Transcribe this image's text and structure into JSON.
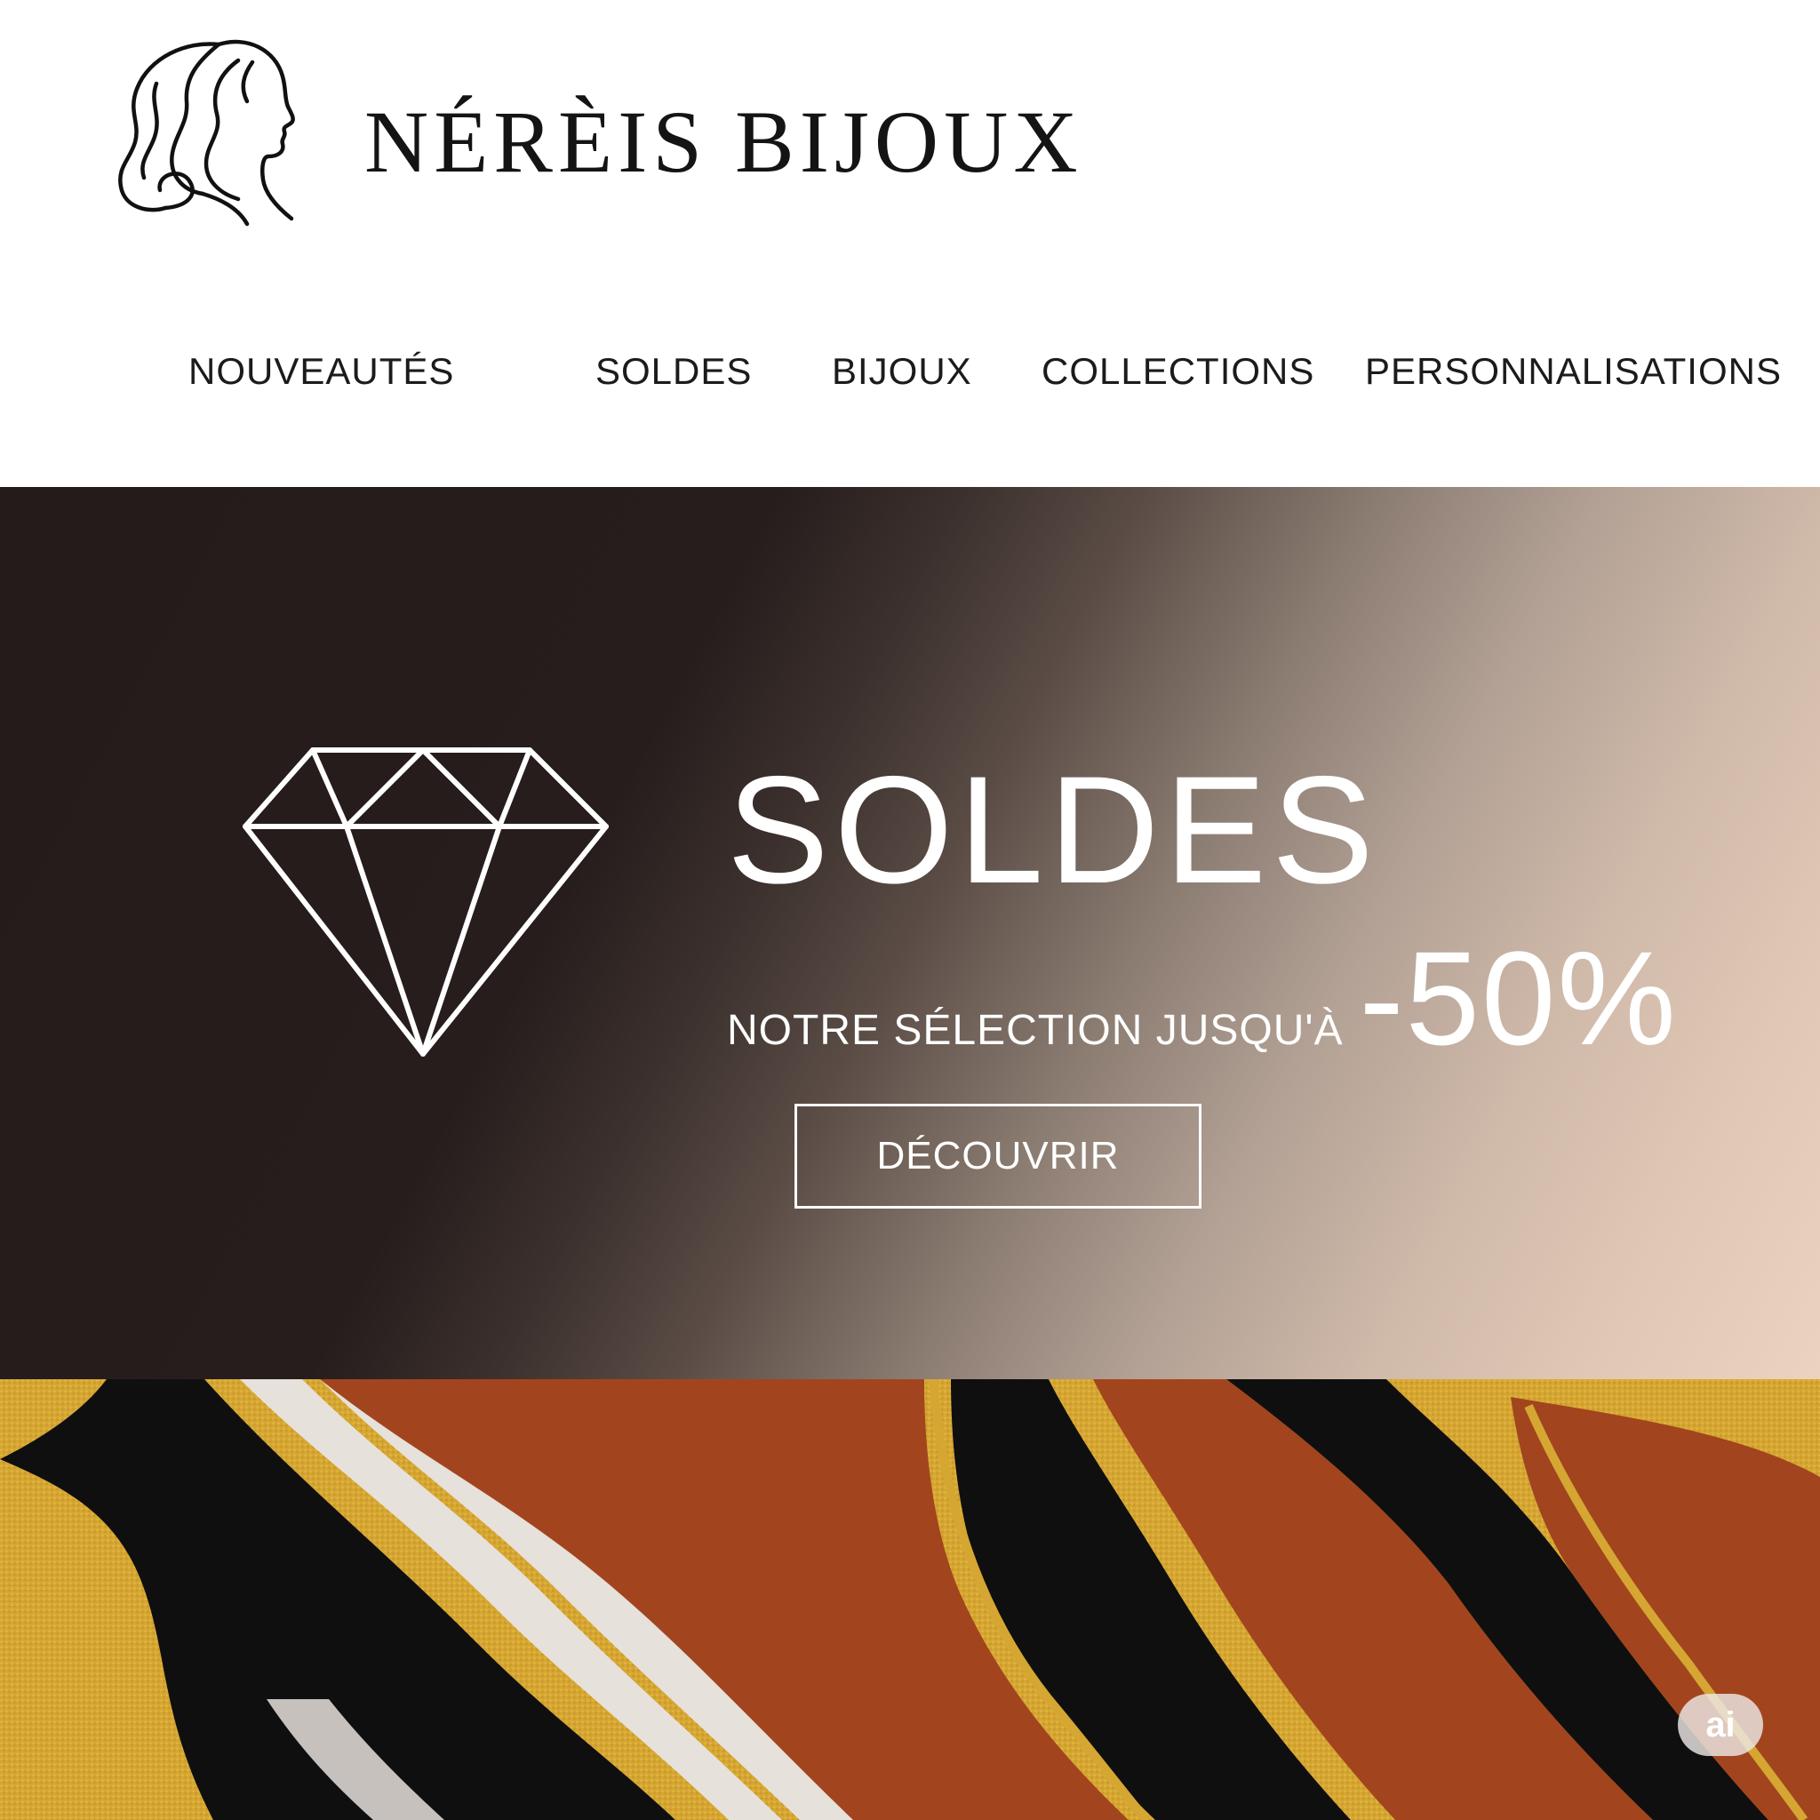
{
  "brand": {
    "name": "NÉRÈIS BIJOUX",
    "logo_icon": "woman-profile-icon"
  },
  "nav": {
    "items": [
      {
        "label": "NOUVEAUTÉS"
      },
      {
        "label": "SOLDES"
      },
      {
        "label": "BIJOUX"
      },
      {
        "label": "COLLECTIONS"
      },
      {
        "label": "PERSONNALISATIONS"
      }
    ]
  },
  "hero": {
    "icon": "diamond-icon",
    "title": "SOLDES",
    "subtitle": "NOTRE SÉLECTION JUSQU'À",
    "discount": "-50%",
    "cta_label": "DÉCOUVRIR",
    "colors": {
      "dark": "#241b1a",
      "light": "#ecd2c0",
      "text": "#ffffff"
    }
  },
  "decor": {
    "colors": {
      "gold": "#d6a632",
      "rust": "#a2451e",
      "black": "#0f0f10",
      "cream": "#e6e1da"
    }
  },
  "badge": {
    "label": "ai"
  }
}
